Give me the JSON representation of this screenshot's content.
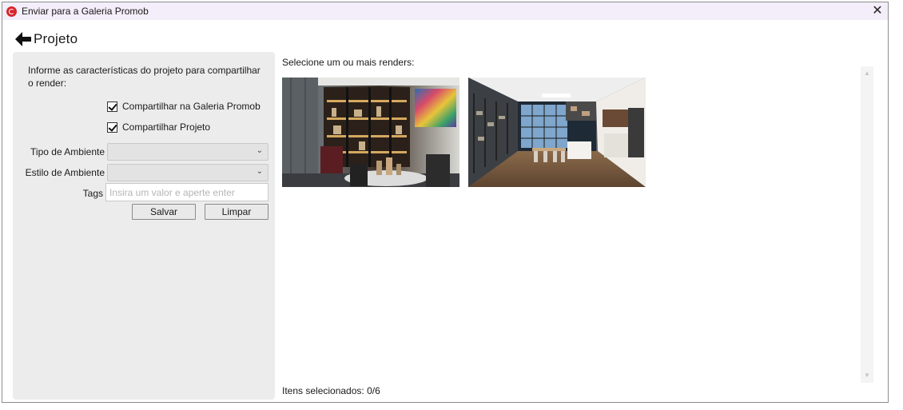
{
  "window": {
    "title": "Enviar para a Galeria Promob",
    "close_glyph": "✕"
  },
  "header": {
    "back_icon": "arrow-left-icon",
    "title": "Projeto"
  },
  "left_panel": {
    "instruction": "Informe as características do projeto para compartilhar o render:",
    "checkboxes": [
      {
        "label": "Compartilhar na Galeria Promob",
        "checked": true
      },
      {
        "label": "Compartilhar Projeto",
        "checked": true
      }
    ],
    "tipo_ambiente": {
      "label": "Tipo de Ambiente",
      "value": ""
    },
    "estilo_ambiente": {
      "label": "Estilo de Ambiente",
      "value": ""
    },
    "tags": {
      "label": "Tags",
      "placeholder": "Insira um valor e aperte enter",
      "value": ""
    },
    "buttons": {
      "save": "Salvar",
      "clear": "Limpar"
    }
  },
  "main": {
    "select_label": "Selecione um ou mais renders:",
    "renders": [
      {
        "name": "render-living-shelves"
      },
      {
        "name": "render-kitchen-dining"
      }
    ],
    "selected_text": "Itens selecionados: 0/6"
  },
  "colors": {
    "accent": "#d7262c",
    "titlebar": "#f3eef9",
    "panel": "#ececec"
  }
}
